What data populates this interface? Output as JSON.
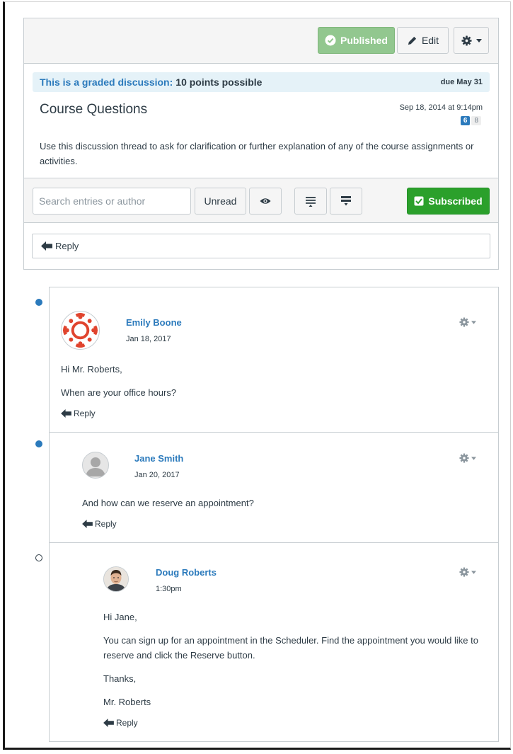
{
  "toolbar": {
    "published_label": "Published",
    "edit_label": "Edit"
  },
  "topic": {
    "graded_label": "This is a graded discussion:",
    "points": "10 points possible",
    "due": "due May 31",
    "title": "Course Questions",
    "date": "Sep 18, 2014 at 9:14pm",
    "unread_count": "6",
    "total_count": "8",
    "body": "Use this discussion thread to ask for clarification or further explanation of any of the course assignments or activities."
  },
  "filters": {
    "search_placeholder": "Search entries or author",
    "unread_label": "Unread",
    "subscribed_label": "Subscribed"
  },
  "reply_label": "Reply",
  "entries": [
    {
      "author": "Emily Boone",
      "date": "Jan 18, 2017",
      "paragraphs": [
        "Hi Mr. Roberts,",
        "When are your office hours?"
      ],
      "reply_label": "Reply"
    },
    {
      "author": "Jane Smith",
      "date": "Jan 20, 2017",
      "paragraphs": [
        "And how can we reserve an appointment?"
      ],
      "reply_label": "Reply"
    },
    {
      "author": "Doug Roberts",
      "date": "1:30pm",
      "paragraphs": [
        "Hi Jane,",
        "You can sign up for an appointment in the Scheduler. Find the appointment you would like to reserve and click the Reserve button.",
        "Thanks,",
        "Mr. Roberts"
      ],
      "reply_label": "Reply"
    }
  ],
  "colors": {
    "link_blue": "#2b7abc",
    "published_green": "#92c78f",
    "subscribed_green": "#2ba02b",
    "graded_bg": "#e5f2f8"
  },
  "icons": [
    "check-circle-icon",
    "pencil-icon",
    "gear-icon",
    "caret-down-icon",
    "eye-icon",
    "collapse-icon",
    "expand-icon",
    "check-square-icon",
    "reply-arrow-icon",
    "unread-dot-icon",
    "read-dot-icon"
  ]
}
